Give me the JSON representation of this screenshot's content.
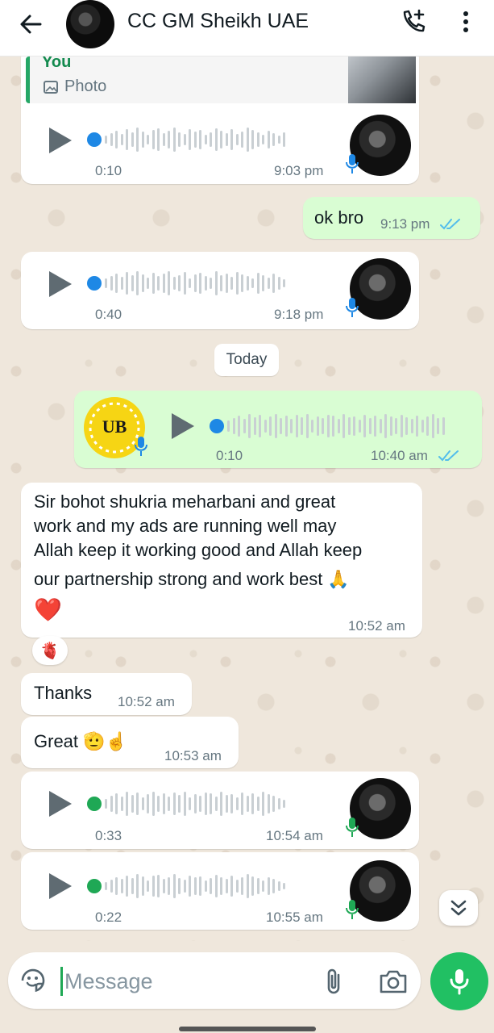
{
  "header": {
    "contact_name": "CC GM Sheikh UAE",
    "icons": [
      "back-arrow-icon",
      "add-call-icon",
      "more-vert-icon"
    ]
  },
  "messages": {
    "reply_preview": {
      "sender": "You",
      "type_label": "Photo"
    },
    "voice1": {
      "duration": "0:10",
      "time": "9:03 pm",
      "played": false
    },
    "text_out1": {
      "text": "ok bro",
      "time": "9:13 pm",
      "status": "read"
    },
    "voice2": {
      "duration": "0:40",
      "time": "9:18 pm",
      "played": false
    },
    "date_separator": "Today",
    "voice_out": {
      "duration": "0:10",
      "time": "10:40 am",
      "status": "read"
    },
    "text_in1": {
      "lines": [
        "Sir bohot shukria meharbani and great",
        "work and my ads are running well may",
        "Allah keep it working good and Allah keep",
        "our partnership strong and work best 🙏"
      ],
      "emoji_line": "❤️",
      "time": "10:52 am",
      "reaction": "🫀"
    },
    "text_in2": {
      "text": "Thanks",
      "time": "10:52 am"
    },
    "text_in3": {
      "text": "Great 🫡☝️",
      "time": "10:53 am"
    },
    "voice3": {
      "duration": "0:33",
      "time": "10:54 am",
      "played": true
    },
    "voice4": {
      "duration": "0:22",
      "time": "10:55 am",
      "played": true
    }
  },
  "composer": {
    "placeholder": "Message"
  },
  "colors": {
    "accent_green": "#21c063",
    "outgoing_bubble": "#d9fdd3",
    "read_ticks": "#53bdeb",
    "unplayed_dot": "#1e88e5",
    "played_dot": "#1fa855"
  }
}
